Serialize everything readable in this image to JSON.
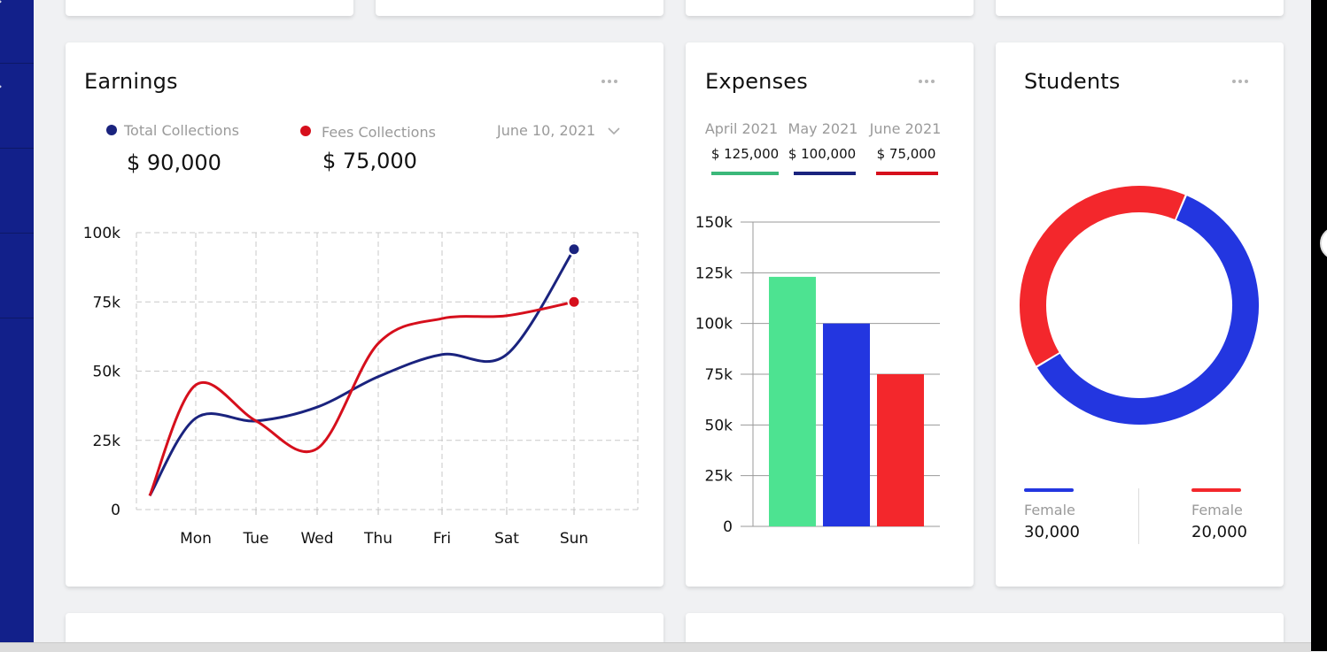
{
  "colors": {
    "sidebar": "#12208a",
    "navy": "#1a237e",
    "red": "#d60f1c",
    "green": "#4de391",
    "blue": "#2336e0",
    "brightRed": "#f3272c"
  },
  "earnings": {
    "title": "Earnings",
    "legend": [
      {
        "label": "Total Collections",
        "value": "$ 90,000",
        "color": "#1a237e"
      },
      {
        "label": "Fees Collections",
        "value": "$ 75,000",
        "color": "#d60f1c"
      }
    ],
    "date": "June 10, 2021",
    "menu_icon": "more-horizontal-icon",
    "dropdown_icon": "chevron-down-icon"
  },
  "expenses": {
    "title": "Expenses",
    "menu_icon": "more-horizontal-icon",
    "legend": [
      {
        "month": "April 2021",
        "value": "$ 125,000",
        "color": "#3bb87a"
      },
      {
        "month": "May 2021",
        "value": "$ 100,000",
        "color": "#1a237e"
      },
      {
        "month": "June 2021",
        "value": "$ 75,000",
        "color": "#d60f1c"
      }
    ]
  },
  "students": {
    "title": "Students",
    "menu_icon": "more-horizontal-icon",
    "legend": [
      {
        "label": "Female",
        "value": "30,000",
        "color": "#2336e0"
      },
      {
        "label": "Female",
        "value": "20,000",
        "color": "#f3272c"
      }
    ]
  },
  "chart_data": [
    {
      "type": "line",
      "title": "",
      "x": [
        "Mon",
        "Tue",
        "Wed",
        "Thu",
        "Fri",
        "Sat",
        "Sun"
      ],
      "ylim": [
        0,
        100000
      ],
      "yticks": [
        "0",
        "25k",
        "50k",
        "75k",
        "100k"
      ],
      "grid": true,
      "series": [
        {
          "name": "Total Collections",
          "color": "#1a237e",
          "values": [
            33000,
            32000,
            37000,
            48000,
            56000,
            56000,
            94000
          ]
        },
        {
          "name": "Fees Collections",
          "color": "#d60f1c",
          "values": [
            45000,
            32000,
            22000,
            60000,
            69000,
            70000,
            75000
          ]
        }
      ]
    },
    {
      "type": "bar",
      "title": "",
      "categories": [
        "April 2021",
        "May 2021",
        "June 2021"
      ],
      "values": [
        123000,
        100000,
        75000
      ],
      "colors": [
        "#4de391",
        "#2336e0",
        "#f3272c"
      ],
      "ylim": [
        0,
        150000
      ],
      "yticks": [
        "0",
        "25k",
        "50k",
        "75k",
        "100k",
        "125k",
        "150k"
      ],
      "grid": true
    },
    {
      "type": "pie",
      "title": "",
      "donut": true,
      "labels": [
        "Female",
        "Female"
      ],
      "values": [
        30000,
        20000
      ],
      "colors": [
        "#2336e0",
        "#f3272c"
      ]
    }
  ]
}
